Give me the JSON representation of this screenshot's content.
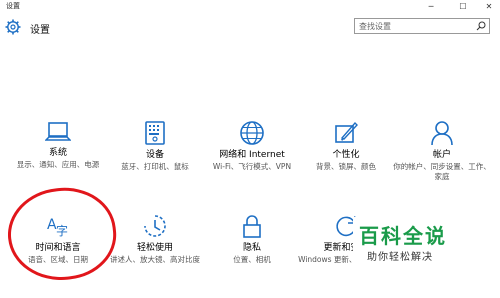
{
  "window": {
    "title": "设置",
    "min_icon": "minimize-icon",
    "max_icon": "maximize-icon",
    "close_icon": "close-icon"
  },
  "header": {
    "title": "设置",
    "search_placeholder": "查找设置"
  },
  "tiles": [
    {
      "name": "系统",
      "desc": "显示、通知、应用、电源",
      "icon": "laptop-icon"
    },
    {
      "name": "设备",
      "desc": "蓝牙、打印机、鼠标",
      "icon": "keyboard-icon"
    },
    {
      "name": "网络和 Internet",
      "desc": "Wi-Fi、飞行模式、VPN",
      "icon": "globe-icon"
    },
    {
      "name": "个性化",
      "desc": "背景、锁屏、颜色",
      "icon": "paint-icon"
    },
    {
      "name": "帐户",
      "desc": "你的帐户、同步设置、工作、家庭",
      "icon": "person-icon"
    },
    {
      "name": "时间和语言",
      "desc": "语音、区域、日期",
      "icon": "language-icon"
    },
    {
      "name": "轻松使用",
      "desc": "讲述人、放大镜、高对比度",
      "icon": "ease-of-access-icon"
    },
    {
      "name": "隐私",
      "desc": "位置、相机",
      "icon": "lock-icon"
    },
    {
      "name": "更新和安全",
      "desc": "Windows 更新、恢复、备份",
      "icon": "update-icon"
    }
  ],
  "watermark": {
    "big": "百科全说",
    "small": "助你轻松解决",
    "color": "#1a9b4a"
  },
  "colors": {
    "accent": "#1e6fc4",
    "annotation": "#e1161b"
  }
}
